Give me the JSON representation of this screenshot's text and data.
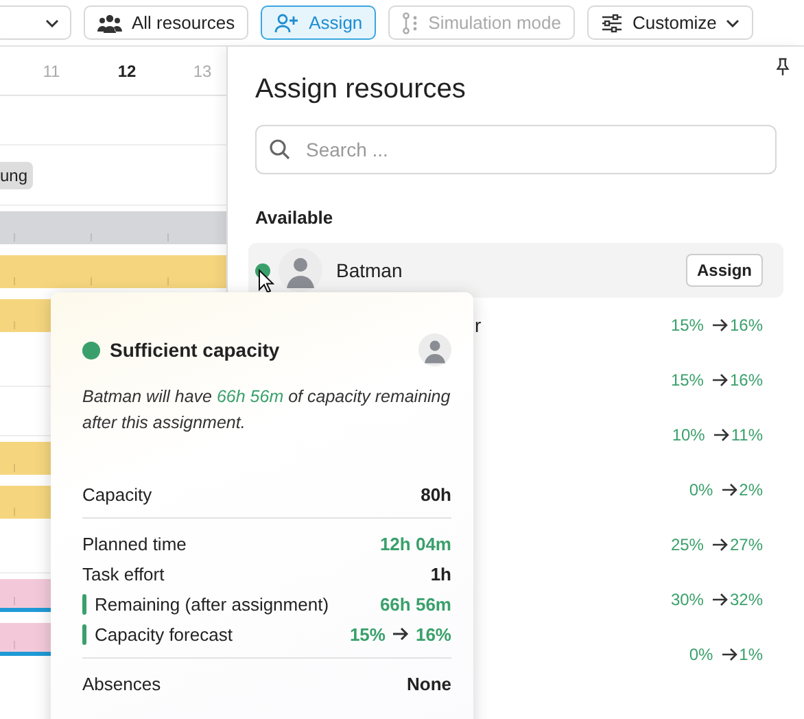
{
  "toolbar": {
    "buttons": [
      {
        "label": "All resources",
        "kind": "filter",
        "selected": false,
        "disabled": false
      },
      {
        "label": "Assign",
        "kind": "assign",
        "selected": true,
        "disabled": false
      },
      {
        "label": "Simulation mode",
        "kind": "simulation",
        "selected": false,
        "disabled": true
      },
      {
        "label": "Customize",
        "kind": "menu",
        "selected": false,
        "disabled": false
      }
    ]
  },
  "calendar": {
    "days": [
      {
        "label": "11",
        "today": false
      },
      {
        "label": "12",
        "today": true
      },
      {
        "label": "13",
        "today": false
      }
    ],
    "lanes": [
      {
        "kind": "gap"
      },
      {
        "kind": "chip",
        "label": "ung"
      },
      {
        "kind": "bar",
        "color": "#d5d6da",
        "underline": false
      },
      {
        "kind": "bar",
        "color": "#f5d67e",
        "underline": false
      },
      {
        "kind": "bar",
        "color": "#f5d67e",
        "underline": false
      },
      {
        "kind": "gap"
      },
      {
        "kind": "gap"
      },
      {
        "kind": "bar",
        "color": "#f5d67e",
        "underline": false
      },
      {
        "kind": "bar",
        "color": "#f5d67e",
        "underline": false
      },
      {
        "kind": "gap"
      },
      {
        "kind": "bar",
        "color": "#f3c9da",
        "underline": true
      },
      {
        "kind": "bar",
        "color": "#f3c9da",
        "underline": true
      }
    ]
  },
  "panel": {
    "title": "Assign resources",
    "search": {
      "placeholder": "Search ..."
    },
    "section": "Available",
    "resources": [
      {
        "name": "Batman",
        "button": "Assign"
      },
      {
        "name": "r",
        "from": "15%",
        "to": "16%"
      },
      {
        "from": "15%",
        "to": "16%"
      },
      {
        "from": "10%",
        "to": "11%"
      },
      {
        "from": "0%",
        "to": "2%"
      },
      {
        "from": "25%",
        "to": "27%"
      },
      {
        "from": "30%",
        "to": "32%"
      },
      {
        "from": "0%",
        "to": "1%"
      }
    ]
  },
  "tooltip": {
    "status": "Sufficient capacity",
    "message": {
      "before": "Batman will have ",
      "highlight": "66h 56m",
      "after": " of capacity remaining after this assignment."
    },
    "groups": [
      [
        {
          "label": "Capacity",
          "value": "80h",
          "green": false,
          "marker": false
        }
      ],
      [
        {
          "label": "Planned time",
          "value": "12h 04m",
          "green": true,
          "marker": false
        },
        {
          "label": "Task effort",
          "value": "1h",
          "green": false,
          "marker": false
        },
        {
          "label": "Remaining (after assignment)",
          "value": "66h 56m",
          "green": true,
          "marker": true
        },
        {
          "label": "Capacity forecast",
          "from": "15%",
          "to": "16%",
          "green": true,
          "marker": true
        }
      ],
      [
        {
          "label": "Absences",
          "value": "None",
          "green": false,
          "marker": false
        }
      ]
    ]
  }
}
